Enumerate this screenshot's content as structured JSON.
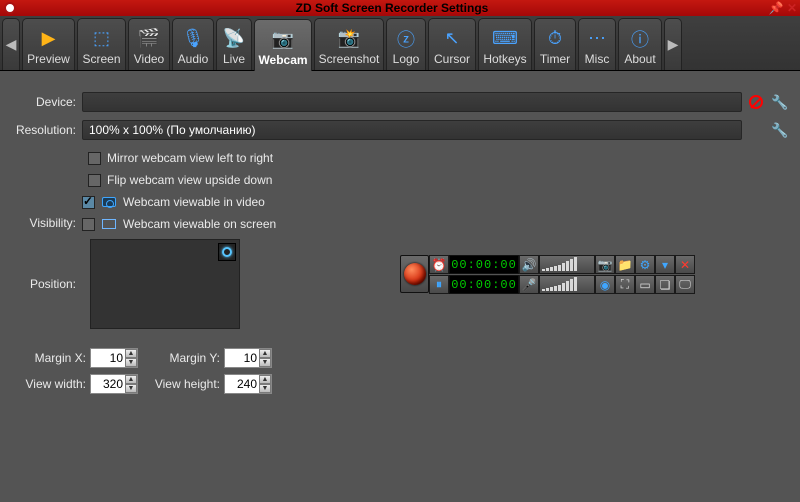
{
  "window": {
    "title": "ZD Soft Screen Recorder Settings"
  },
  "tabs": [
    {
      "label": "Preview",
      "icon": "▶"
    },
    {
      "label": "Screen",
      "icon": "⬚"
    },
    {
      "label": "Video",
      "icon": "🎬"
    },
    {
      "label": "Audio",
      "icon": "🎙"
    },
    {
      "label": "Live",
      "icon": "📡"
    },
    {
      "label": "Webcam",
      "icon": "📷"
    },
    {
      "label": "Screenshot",
      "icon": "📸"
    },
    {
      "label": "Logo",
      "icon": "ⓩ"
    },
    {
      "label": "Cursor",
      "icon": "↖"
    },
    {
      "label": "Hotkeys",
      "icon": "⌨"
    },
    {
      "label": "Timer",
      "icon": "⏱"
    },
    {
      "label": "Misc",
      "icon": "⋯"
    },
    {
      "label": "About",
      "icon": "ⓘ"
    }
  ],
  "active_tab_index": 5,
  "form": {
    "device_label": "Device:",
    "device_value": "",
    "resolution_label": "Resolution:",
    "resolution_value": "100% x 100% (По умолчанию)",
    "visibility_label": "Visibility:",
    "mirror_label": "Mirror webcam view left to right",
    "mirror_checked": false,
    "flip_label": "Flip webcam view upside down",
    "flip_checked": false,
    "viewable_video_label": "Webcam viewable in video",
    "viewable_video_checked": true,
    "viewable_screen_label": "Webcam viewable on screen",
    "viewable_screen_checked": false,
    "position_label": "Position:",
    "marginx_label": "Margin X:",
    "marginx_value": "10",
    "marginy_label": "Margin Y:",
    "marginy_value": "10",
    "viewwidth_label": "View width:",
    "viewwidth_value": "320",
    "viewheight_label": "View height:",
    "viewheight_value": "240"
  },
  "toolbar": {
    "time": "00:00:00"
  }
}
